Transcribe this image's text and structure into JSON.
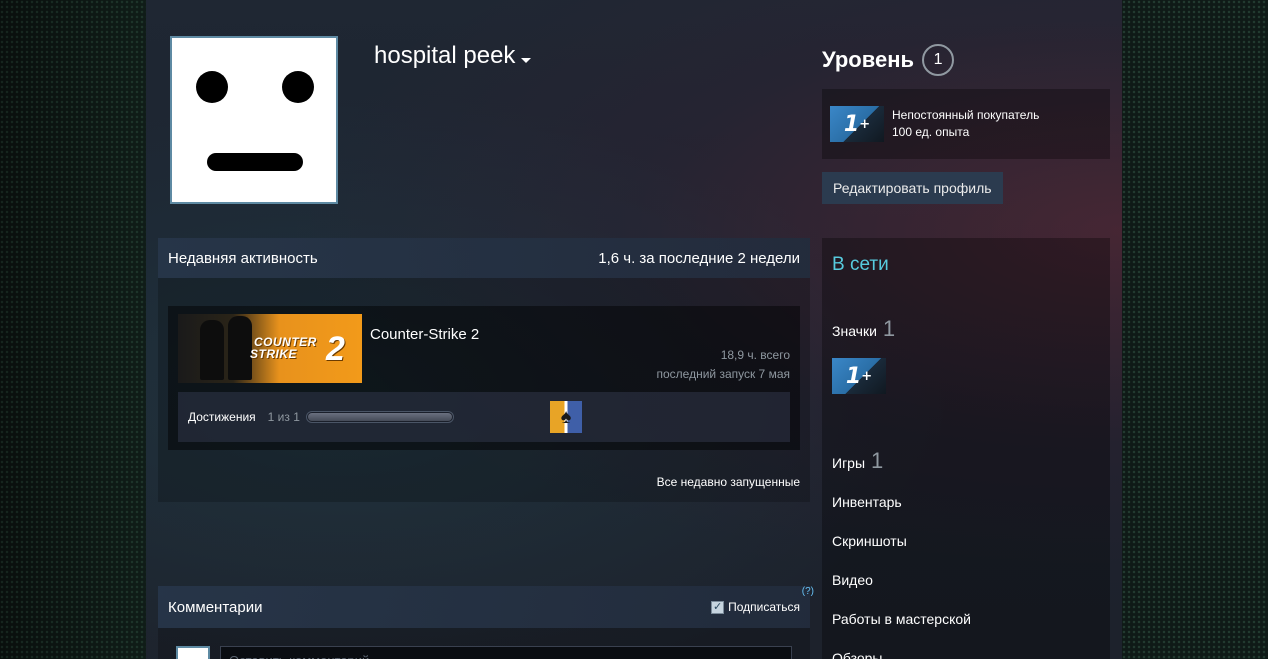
{
  "profile": {
    "persona_name": "hospital peek",
    "level_label": "Уровень",
    "level_value": "1",
    "badge": {
      "icon_text": "1",
      "icon_sup": "+",
      "title": "Непостоянный покупатель",
      "xp": "100 ед. опыта"
    },
    "edit_button": "Редактировать профиль"
  },
  "activity": {
    "title": "Недавняя активность",
    "summary": "1,6 ч. за последние 2 недели",
    "game": {
      "name": "Counter-Strike 2",
      "capsule_line1": "COUNTER",
      "capsule_line2": "STRIKE",
      "capsule_number": "2",
      "total_hours": "18,9 ч. всего",
      "last_played": "последний запуск 7 мая",
      "achievements_label": "Достижения",
      "achievements_count": "1 из 1",
      "achievements_progress": 1.0
    },
    "all_recent_link": "Все недавно запущенные"
  },
  "comments": {
    "title": "Комментарии",
    "subscribe_label": "Подписаться",
    "help_mark": "(?)",
    "input_placeholder": "Оставить комментарий"
  },
  "sidebar": {
    "status": "В сети",
    "badges_label": "Значки",
    "badges_count": "1",
    "games_label": "Игры",
    "games_count": "1",
    "links": [
      "Инвентарь",
      "Скриншоты",
      "Видео",
      "Работы в мастерской",
      "Обзоры"
    ]
  },
  "colors": {
    "status_online": "#57cbde",
    "button_bg": "#2b3b4f",
    "badge_blue": "#3a87c8"
  }
}
